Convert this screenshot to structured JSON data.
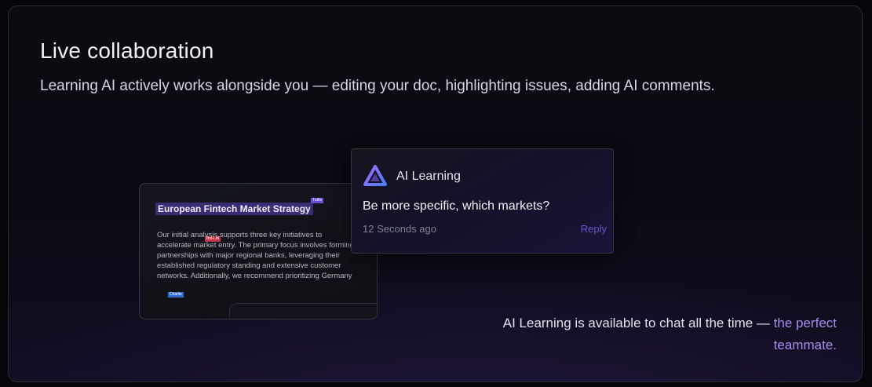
{
  "section": {
    "title": "Live collaboration",
    "subtitle": "Learning AI actively works alongside you — editing your doc, highlighting issues, adding AI comments."
  },
  "document": {
    "title": "European Fintech Market Strategy",
    "body": "Our initial analysis supports three key initiatives to accelerate market entry. The primary focus involves forming partnerships with major regional banks, leveraging their established regulatory standing and extensive customer networks. Additionally, we recommend prioritizing Germany",
    "tags": {
      "purple": "Tuttle",
      "red": "Bot-LM",
      "blue": "Charlie"
    }
  },
  "comment": {
    "author": "AI Learning",
    "message": "Be more specific, which markets?",
    "timestamp": "12 Seconds ago",
    "reply_label": "Reply",
    "logo_icon": "ai-learning-logo-icon"
  },
  "tagline": {
    "text": "AI Learning is available to chat all the time —",
    "highlight": "the perfect teammate."
  },
  "colors": {
    "accent": "#a98ef0",
    "reply": "#6c55c9",
    "doc_title_highlight": "#3a2d73"
  }
}
